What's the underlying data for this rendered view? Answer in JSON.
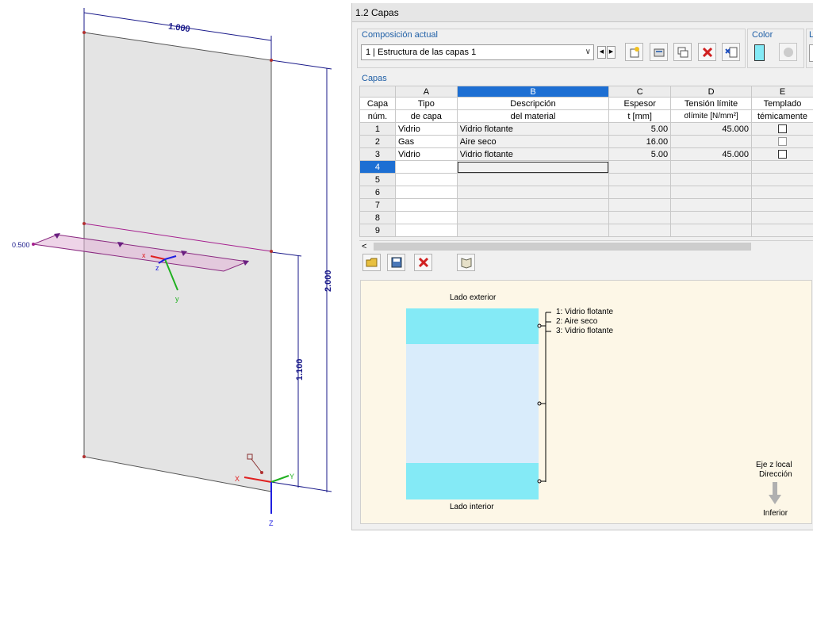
{
  "model": {
    "dim_width": "1.000",
    "dim_height": "2.000",
    "dim_partial": "1.100",
    "load_label": "0.500",
    "axes": {
      "x": "x",
      "y": "y",
      "z": "z",
      "X": "X",
      "Y": "Y",
      "Z": "Z"
    }
  },
  "panel": {
    "title": "1.2 Capas",
    "composition": {
      "label": "Composición actual",
      "value": "1 | Estructura de las capas 1"
    },
    "color_label": "Color",
    "next_group_label": "L",
    "layers_label": "Capas",
    "table": {
      "col_letters": [
        "A",
        "B",
        "C",
        "D",
        "E"
      ],
      "headers": {
        "rownum": [
          "Capa",
          "núm."
        ],
        "A": [
          "Tipo",
          "de capa"
        ],
        "B": [
          "Descripción",
          "del material"
        ],
        "C": [
          "Espesor",
          "t [mm]"
        ],
        "D": [
          "Tensión límite",
          "σlímite [N/mm²]"
        ],
        "E": [
          "Templado",
          "témicamente"
        ]
      },
      "rows": [
        {
          "n": "1",
          "type": "Vidrio",
          "desc": "Vidrio flotante",
          "t": "5.00",
          "sigma": "45.000",
          "check": "unchecked"
        },
        {
          "n": "2",
          "type": "Gas",
          "desc": "Aire seco",
          "t": "16.00",
          "sigma": "",
          "check": "disabled"
        },
        {
          "n": "3",
          "type": "Vidrio",
          "desc": "Vidrio flotante",
          "t": "5.00",
          "sigma": "45.000",
          "check": "unchecked"
        },
        {
          "n": "4",
          "type": "",
          "desc": "",
          "t": "",
          "sigma": "",
          "check": ""
        },
        {
          "n": "5",
          "type": "",
          "desc": "",
          "t": "",
          "sigma": "",
          "check": ""
        },
        {
          "n": "6",
          "type": "",
          "desc": "",
          "t": "",
          "sigma": "",
          "check": ""
        },
        {
          "n": "7",
          "type": "",
          "desc": "",
          "t": "",
          "sigma": "",
          "check": ""
        },
        {
          "n": "8",
          "type": "",
          "desc": "",
          "t": "",
          "sigma": "",
          "check": ""
        },
        {
          "n": "9",
          "type": "",
          "desc": "",
          "t": "",
          "sigma": "",
          "check": ""
        }
      ]
    },
    "preview": {
      "top_label": "Lado exterior",
      "bottom_label": "Lado interior",
      "legend": [
        "1: Vidrio flotante",
        "2: Aire seco",
        "3: Vidrio flotante"
      ],
      "axis_title_1": "Eje z local",
      "axis_title_2": "Dirección",
      "axis_dir": "Inferior",
      "glass_color": "#84eaf6",
      "gas_color": "#d9ecfb"
    }
  }
}
